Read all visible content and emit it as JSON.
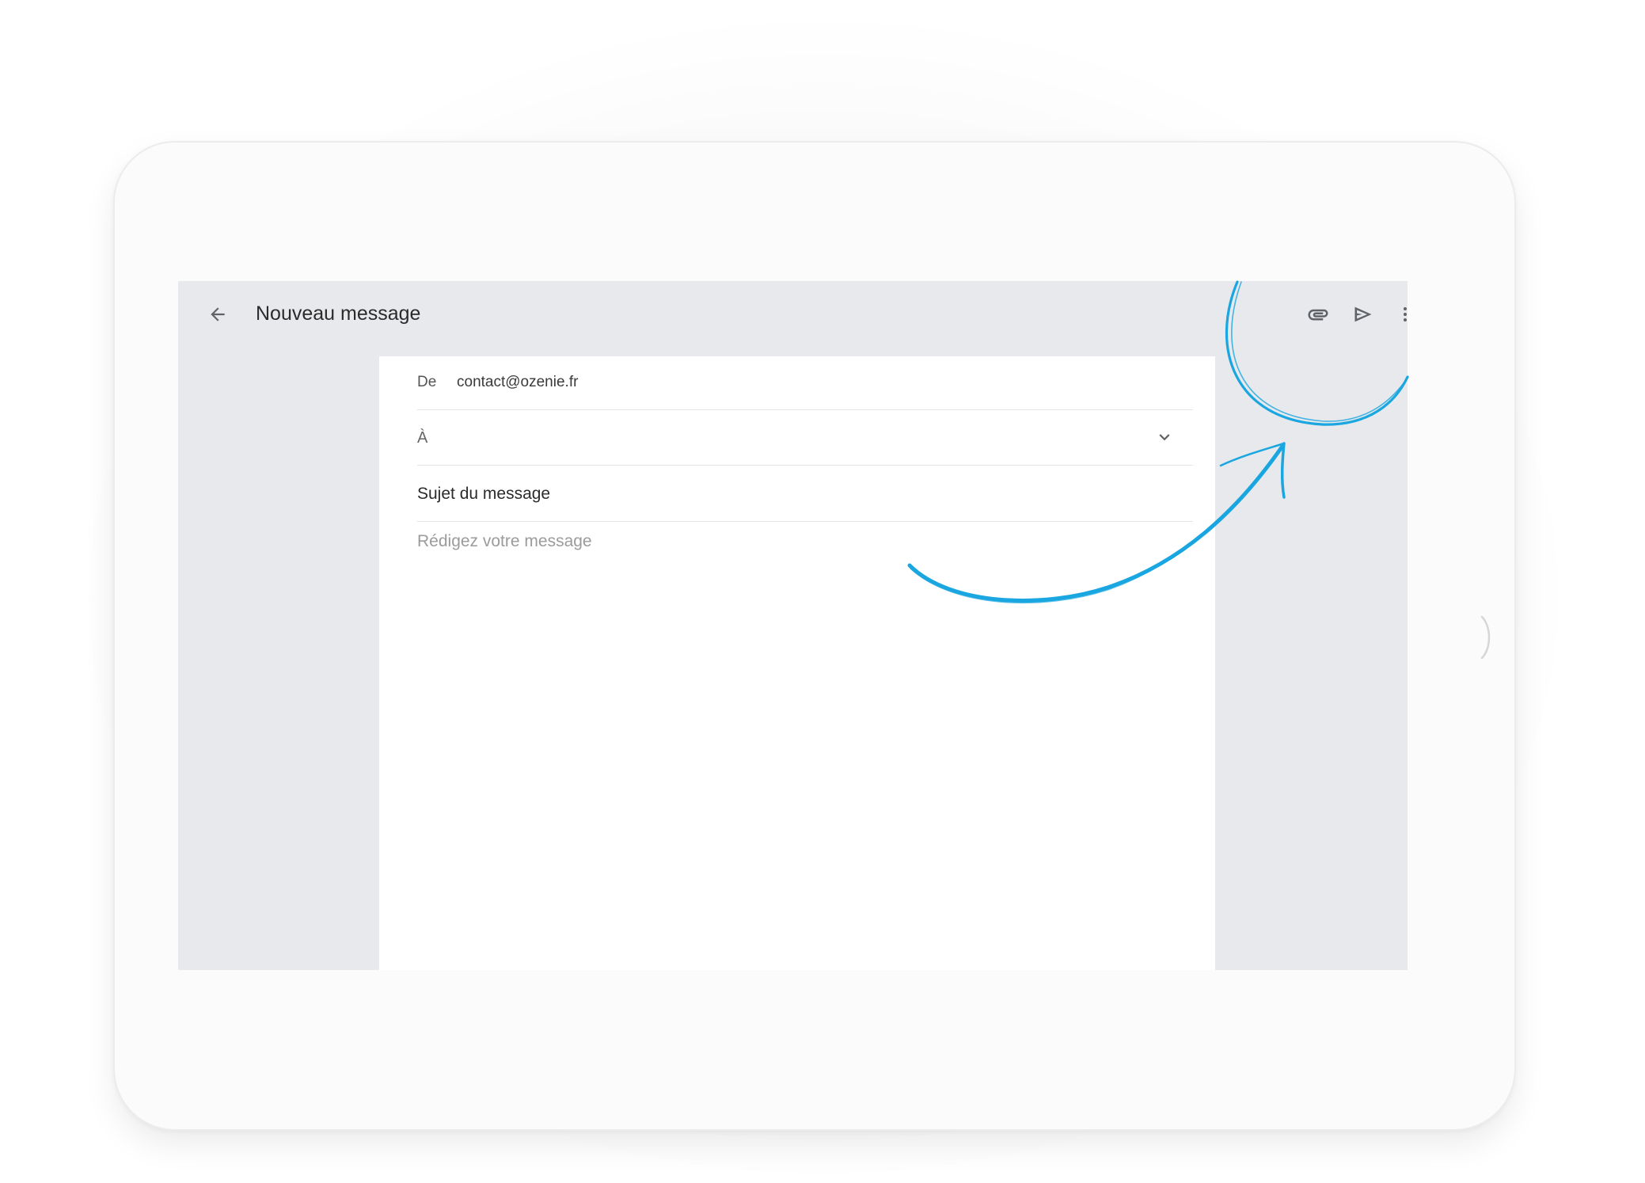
{
  "header": {
    "title": "Nouveau message",
    "back_icon": "arrow-left-icon",
    "actions": [
      {
        "name": "attach",
        "icon": "paperclip-icon"
      },
      {
        "name": "send",
        "icon": "send-icon"
      },
      {
        "name": "more",
        "icon": "more-vertical-icon"
      }
    ]
  },
  "compose": {
    "from_label": "De",
    "from_value": "contact@ozenie.fr",
    "to_label": "À",
    "to_value": "",
    "subject": "Sujet du message",
    "body_placeholder": "Rédigez votre message"
  },
  "colors": {
    "screen_bg": "#e8e9ec",
    "compose_bg": "#ffffff",
    "icon": "#5f6368",
    "annotation": "#1aa6e0"
  }
}
